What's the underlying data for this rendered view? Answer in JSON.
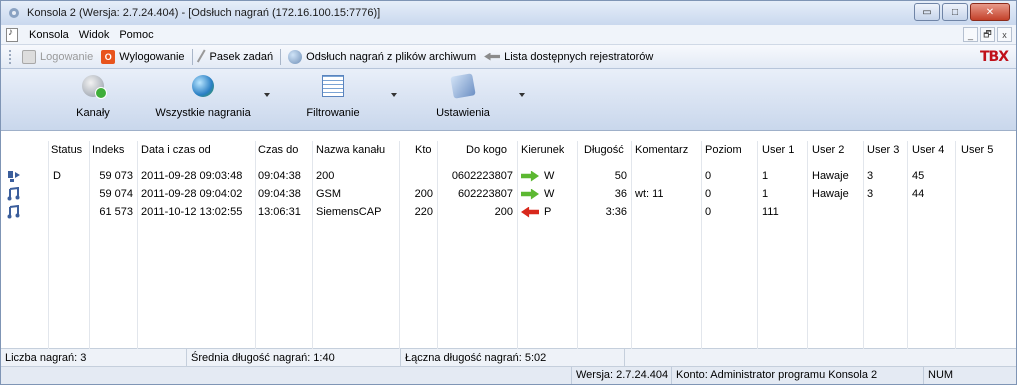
{
  "window": {
    "title": "Konsola 2 (Wersja:  2.7.24.404) - [Odsłuch nagrań (172.16.100.15:7776)]",
    "controls": {
      "minimize": "▭",
      "maximize": "□",
      "close": "✕"
    }
  },
  "menu": {
    "items": [
      "Konsola",
      "Widok",
      "Pomoc"
    ],
    "mdi_controls": {
      "minimize": "_",
      "restore": "🗗",
      "close": "x"
    }
  },
  "commandbar": {
    "login": "Logowanie",
    "logout": "Wylogowanie",
    "taskbar": "Pasek zadań",
    "archive": "Odsłuch nagrań z plików archiwum",
    "recorders": "Lista dostępnych rejestratorów",
    "logo": "TBX"
  },
  "toolbar": {
    "channels": "Kanały",
    "all_recordings": "Wszystkie nagrania",
    "filtering": "Filtrowanie",
    "settings": "Ustawienia"
  },
  "table": {
    "headers": [
      "Status",
      "Indeks",
      "Data i czas od",
      "Czas do",
      "Nazwa kanału",
      "Kto",
      "Do kogo",
      "Kierunek",
      "Długość",
      "Komentarz",
      "Poziom",
      "User 1",
      "User 2",
      "User 3",
      "User 4",
      "User 5"
    ],
    "rows": [
      {
        "status": "D",
        "indeks": "59 073",
        "data_od": "2011-09-28 09:03:48",
        "czas_do": "09:04:38",
        "kanal": "200",
        "kto": "",
        "do_kogo": "0602223807",
        "kierunek": "W",
        "dlugosc": "50",
        "komentarz": "",
        "poziom": "0",
        "user1": "1",
        "user2": "Hawaje",
        "user3": "3",
        "user4": "45",
        "user5": "",
        "icon": "play-icon",
        "arrow": "green"
      },
      {
        "status": "",
        "indeks": "59 074",
        "data_od": "2011-09-28 09:04:02",
        "czas_do": "09:04:38",
        "kanal": "GSM",
        "kto": "200",
        "do_kogo": "602223807",
        "kierunek": "W",
        "dlugosc": "36",
        "komentarz": "wt: 11",
        "poziom": "0",
        "user1": "1",
        "user2": "Hawaje",
        "user3": "3",
        "user4": "44",
        "user5": "",
        "icon": "music-note-icon",
        "arrow": "green"
      },
      {
        "status": "",
        "indeks": "61 573",
        "data_od": "2011-10-12 13:02:55",
        "czas_do": "13:06:31",
        "kanal": "SiemensCAP",
        "kto": "220",
        "do_kogo": "200",
        "kierunek": "P",
        "dlugosc": "3:36",
        "komentarz": "",
        "poziom": "0",
        "user1": "111",
        "user2": "",
        "user3": "",
        "user4": "",
        "user5": "",
        "icon": "music-note-icon",
        "arrow": "red"
      }
    ]
  },
  "summary": {
    "count": "Liczba nagrań:  3",
    "avg": "Średnia długość nagrań:  1:40",
    "total": "Łączna długość nagrań: 5:02"
  },
  "status": {
    "version": "Wersja: 2.7.24.404",
    "account": "Konto: Administrator programu Konsola 2",
    "num": "NUM"
  }
}
